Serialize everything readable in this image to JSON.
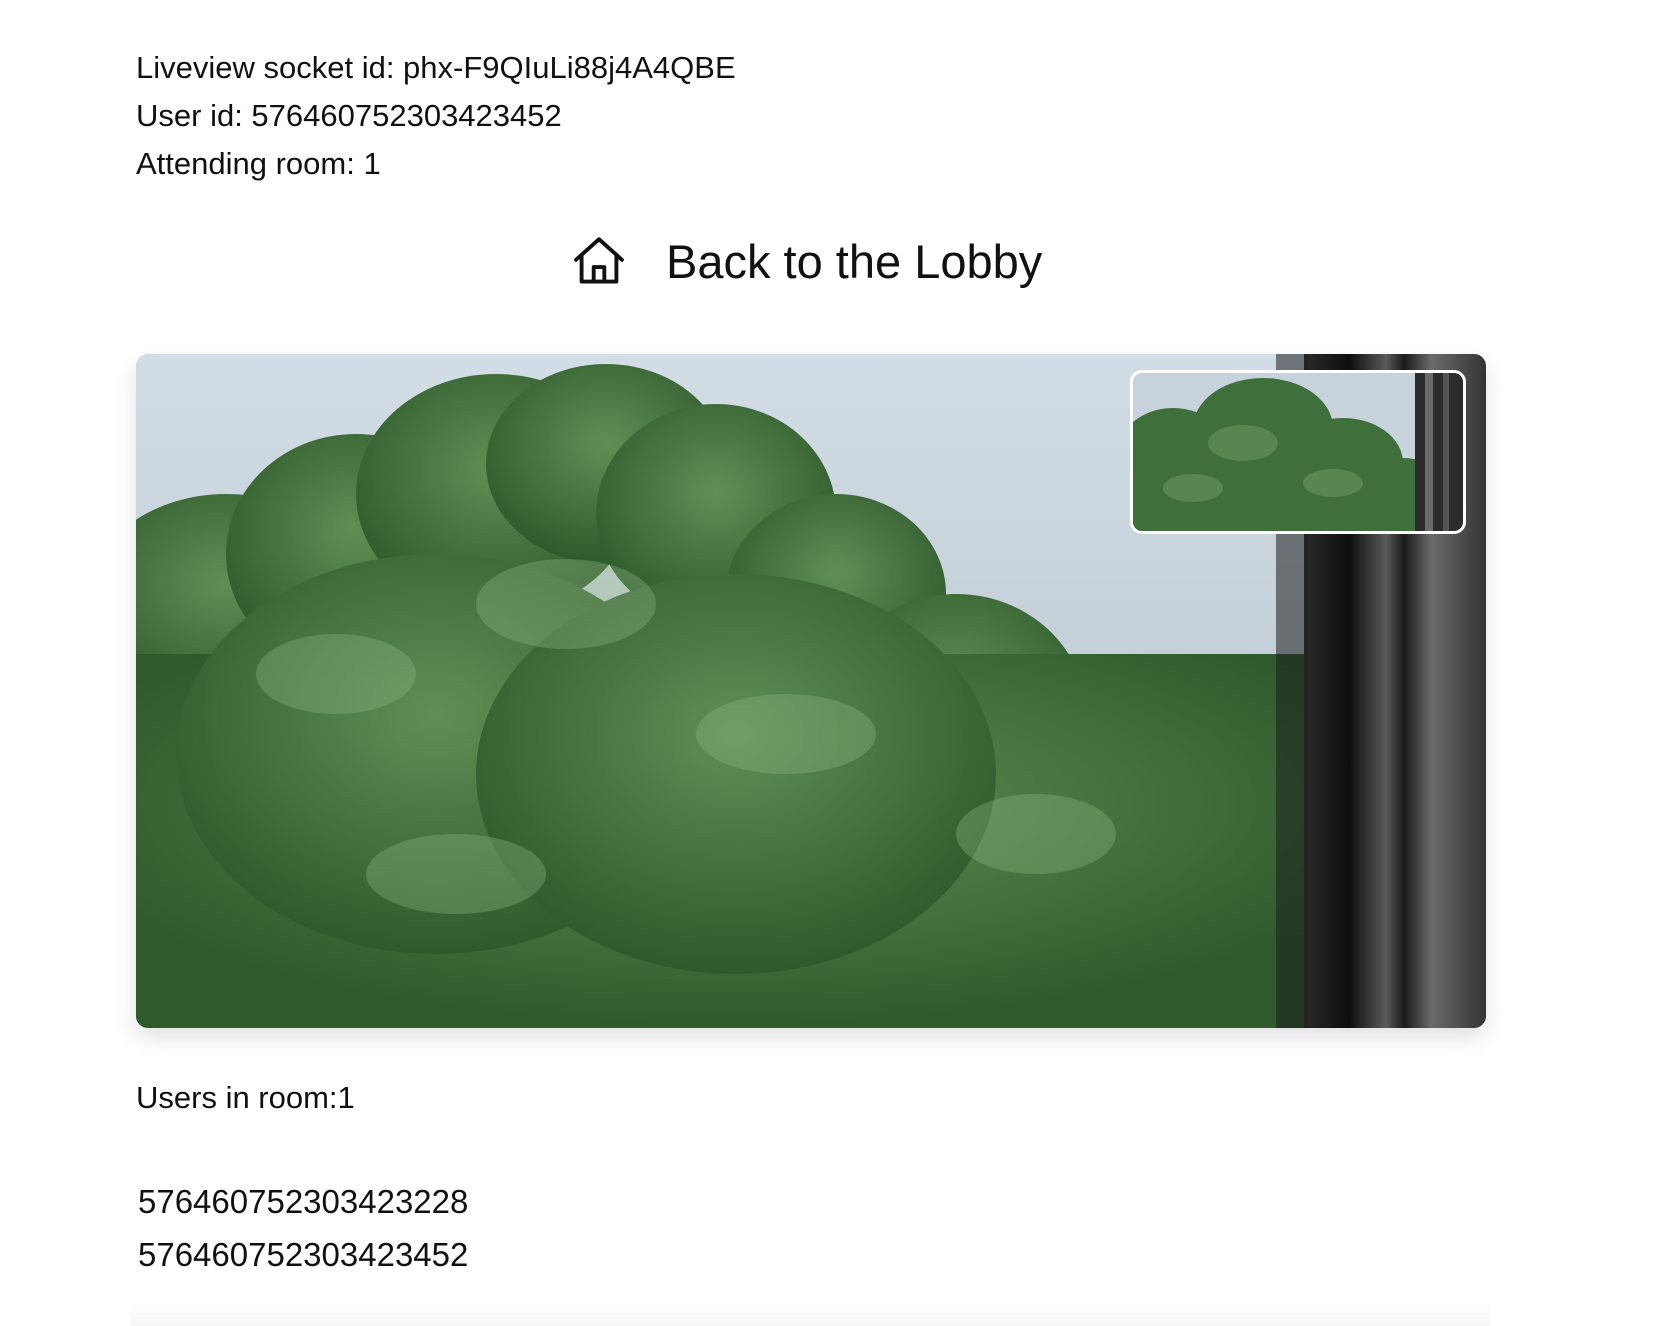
{
  "info": {
    "socket_id": "Liveview socket id: phx-F9QIuLi88j4A4QBE",
    "user_id": "User id: 576460752303423452",
    "room": "Attending room: 1"
  },
  "lobby": {
    "label": "Back to the Lobby",
    "icon": "home-icon"
  },
  "video": {
    "main_feed": "remote-video",
    "pip_feed": "local-video"
  },
  "users": {
    "heading": "Users in room:1",
    "list": [
      "576460752303423228",
      "576460752303423452"
    ]
  }
}
